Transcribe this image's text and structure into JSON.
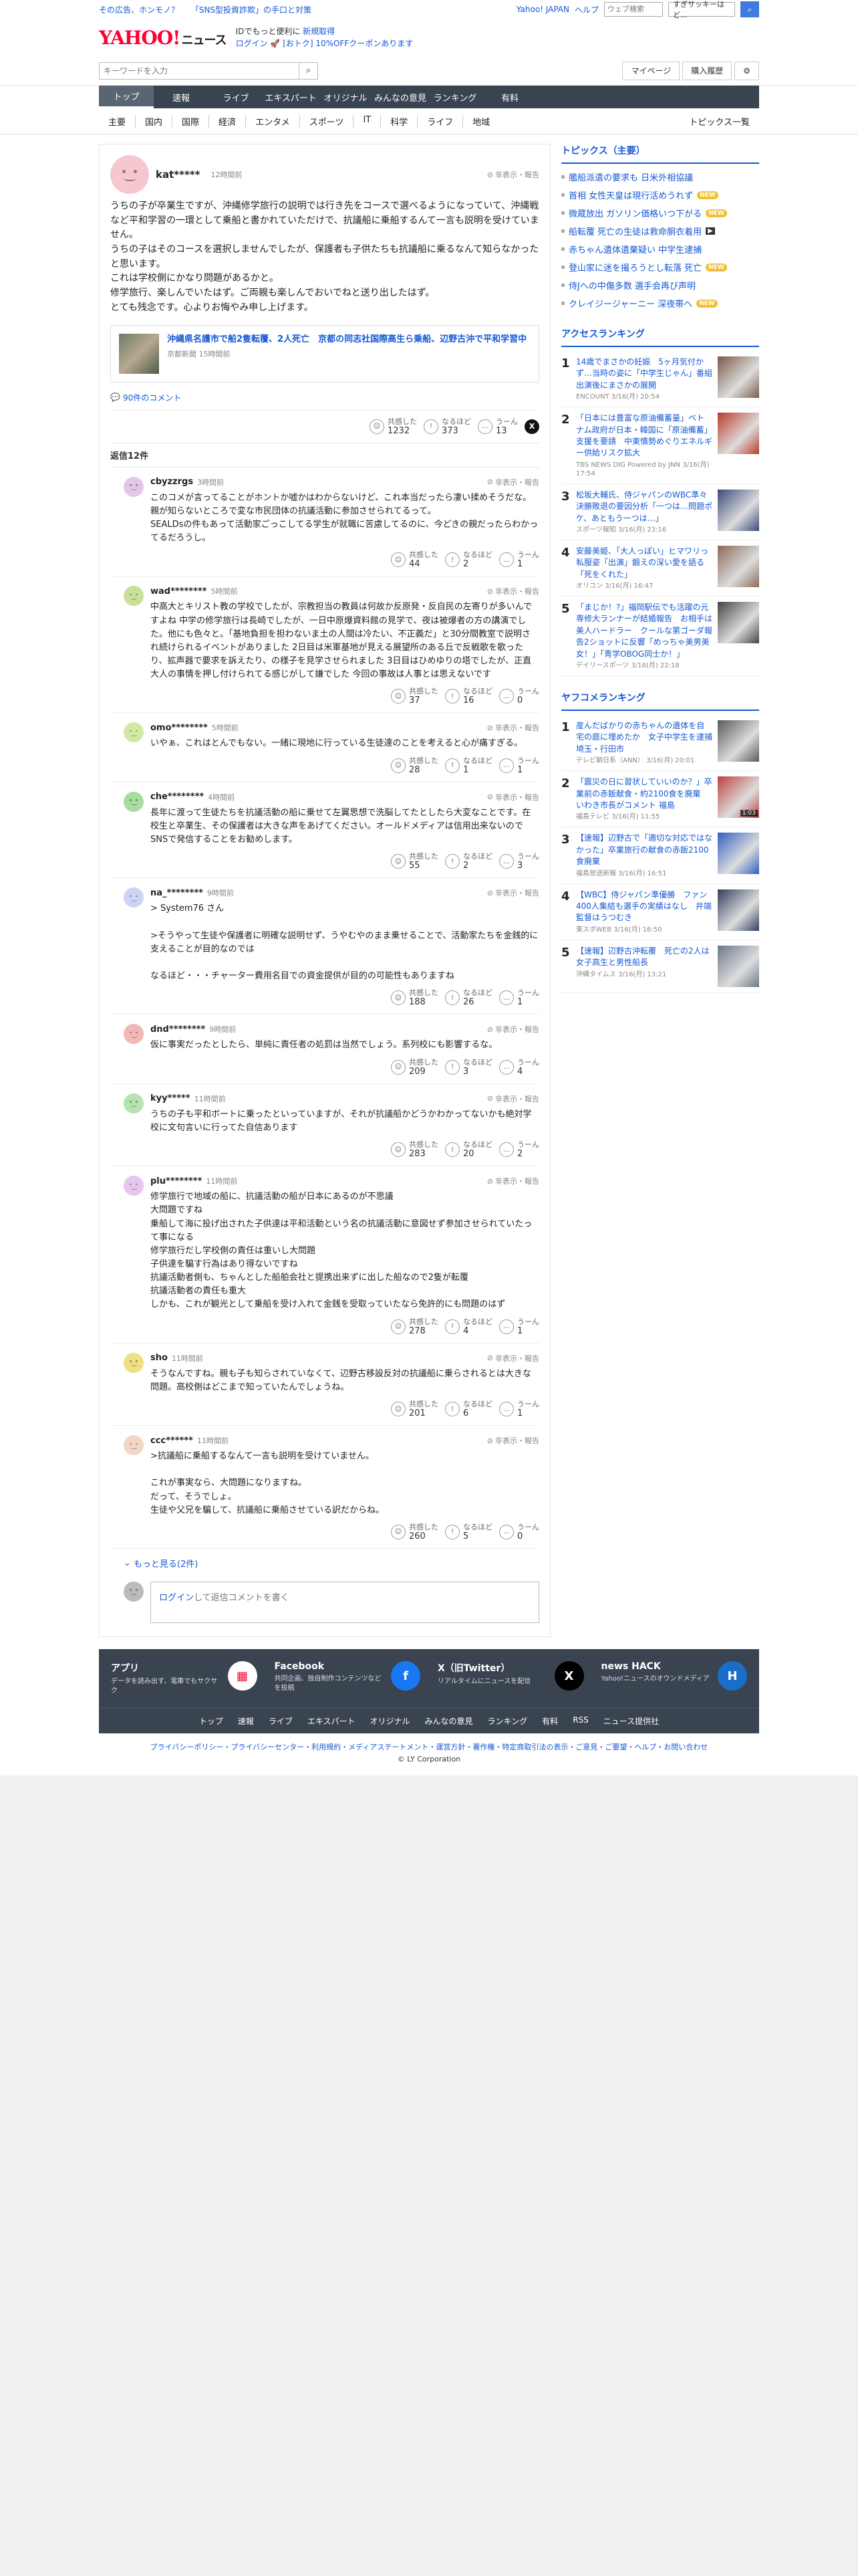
{
  "promo": {
    "links": [
      "その広告、ホンモノ？",
      "「SNS型投資詐欺」の手口と対策"
    ],
    "yahoo_japan": "Yahoo! JAPAN",
    "help": "ヘルプ",
    "search_placeholder": "ウェブ検索",
    "pill": "すぎサッキーはど...",
    "search_icon": "search-icon"
  },
  "masthead": {
    "logo": "YAHOO!",
    "logo_sub": "JAPAN",
    "brand": "ニュース",
    "msg1": "IDでもっと便利に",
    "msg1_link": "新規取得",
    "login": "ログイン",
    "msg2": "[おトク] 10%OFFクーポンあります"
  },
  "searchrow": {
    "placeholder": "キーワードを入力",
    "mypage": "マイページ",
    "purchase": "購入履歴"
  },
  "nav": [
    "トップ",
    "速報",
    "ライブ",
    "エキスパート",
    "オリジナル",
    "みんなの意見",
    "ランキング",
    "有料"
  ],
  "subnav": {
    "items": [
      "主要",
      "国内",
      "国際",
      "経済",
      "エンタメ",
      "スポーツ",
      "IT",
      "科学",
      "ライフ",
      "地域"
    ],
    "topics_list": "トピックス一覧"
  },
  "main_comment": {
    "user": "kat*****",
    "time": "12時間前",
    "report": "非表示・報告",
    "text": "うちの子が卒業生ですが、沖縄修学旅行の説明では行き先をコースで選べるようになっていて、沖縄戦など平和学習の一環として乗船と書かれていただけで、抗議船に乗船するんて一言も説明を受けていません。\nうちの子はそのコースを選択しませんでしたが、保護者も子供たちも抗議船に乗るなんて知らなかったと思います。\nこれは学校側にかなり問題があるかと。\n修学旅行、楽しんでいたはず。ご両親も楽しんでおいでねと送り出したはず。\nとても残念です。心よりお悔やみ申し上げます。",
    "article_title": "沖縄県名護市で船2隻転覆、2人死亡　京都の同志社国際高生ら乗船、辺野古沖で平和学習中",
    "article_src": "京都新聞 15時間前",
    "comments_link": "90件のコメント",
    "agree": "1232",
    "naruhodo": "373",
    "uun": "13"
  },
  "labels": {
    "agree": "共感した",
    "naruhodo": "なるほど",
    "uun": "うーん",
    "report": "非表示・報告"
  },
  "replies_header": "返信12件",
  "replies": [
    {
      "name": "cbyzzrgs",
      "time": "3時間前",
      "color": "#e3c6ea",
      "text": "このコメが言ってることがホントか嘘かはわからないけど、これ本当だったら凄い揉めそうだな。\n親が知らないところで変な市民団体の抗議活動に参加させられてるって。\nSEALDsの件もあって活動家ごっこしてる学生が就職に苦慮してるのに、今どきの親だったらわかってるだろうし。",
      "agree": "44",
      "naruhodo": "2",
      "uun": "1"
    },
    {
      "name": "wad********",
      "time": "5時間前",
      "color": "#c9e09a",
      "text": "中高大とキリスト教の学校でしたが、宗教担当の教員は何故か反原発・反自民の左寄りが多いんですよね 中学の修学旅行は長崎でしたが、一日中原爆資料館の見学で、夜は被爆者の方の講演でした。他にも色々と。「基地負担を担わないま土の人間は冷たい、不正義だ」と30分間教室で説明され続けられるイベントがありました 2日目は米軍基地が見える展望所のある丘で反戦歌を歌ったり、拡声器で要求を訴えたり、の様子を見学させられました 3日目はひめゆりの塔でしたが、正直大人の事情を押し付けられてる感じがして嫌でした 今回の事故は人事とは思えないです",
      "agree": "37",
      "naruhodo": "16",
      "uun": "0"
    },
    {
      "name": "omo********",
      "time": "5時間前",
      "color": "#d4e8a6",
      "text": "いやぁ、これはとんでもない。一緒に現地に行っている生徒達のことを考えると心が痛すぎる。",
      "agree": "28",
      "naruhodo": "1",
      "uun": "1"
    },
    {
      "name": "che********",
      "time": "4時間前",
      "color": "#a8dca0",
      "text": "長年に渡って生徒たちを抗議活動の船に乗せて左翼思想で洗脳してたとしたら大変なことです。在校生と卒業生、その保護者は大きな声をあげてください。オールドメディアは信用出来ないのでSNSで発信することをお勧めします。",
      "agree": "55",
      "naruhodo": "2",
      "uun": "3"
    },
    {
      "name": "na_********",
      "time": "9時間前",
      "color": "#cdd3f2",
      "text": "> System76 さん\n\n>そうやって生徒や保護者に明確な説明せず、うやむやのまま乗せることで、活動家たちを金銭的に支えることが目的なのでは\n\nなるほど・・・チャーター費用名目での資金提供が目的の可能性もありますね",
      "agree": "188",
      "naruhodo": "26",
      "uun": "1"
    },
    {
      "name": "dnd********",
      "time": "9時間前",
      "color": "#f2b8b8",
      "text": "仮に事実だったとしたら、単純に責任者の処罰は当然でしょう。系列校にも影響するな。",
      "agree": "209",
      "naruhodo": "3",
      "uun": "4"
    },
    {
      "name": "kyy*****",
      "time": "11時間前",
      "color": "#b5e3b2",
      "text": "うちの子も平和ボートに乗ったといっていますが、それが抗議船かどうかわかってないかも絶対学校に文句言いに行ってた自信あります",
      "agree": "283",
      "naruhodo": "20",
      "uun": "2"
    },
    {
      "name": "plu********",
      "time": "11時間前",
      "color": "#e8c6ef",
      "text": "修学旅行で地域の船に、抗議活動の船が日本にあるのが不思議\n大問題ですね\n乗船して海に投げ出された子供達は平和活動という名の抗議活動に意図せず参加させられていたって事になる\n修学旅行だし学校側の責任は重いし大問題\n子供達を騙す行為はあり得ないですね\n抗議活動者側も、ちゃんとした船舶会社と提携出来ずに出した船なので2隻が転覆\n抗議活動者の責任も重大\nしかも、これが観光として乗船を受け入れて金銭を受取っていたなら免許的にも問題のはず",
      "agree": "278",
      "naruhodo": "4",
      "uun": "1"
    },
    {
      "name": "sho",
      "time": "11時間前",
      "color": "#f1df86",
      "text": "そうなんですね。親も子も知らされていなくて、辺野古移設反対の抗議船に乗らされるとは大きな問題。高校側はどこまで知っていたんでしょうね。",
      "agree": "201",
      "naruhodo": "6",
      "uun": "1"
    },
    {
      "name": "ccc******",
      "time": "11時間前",
      "color": "#f2d7c8",
      "text": ">抗議船に乗船するなんて一言も説明を受けていません。\n\nこれが事実なら、大問題になりますね。\nだって、そうでしょ。\n生徒や父兄を騙して、抗議船に乗船させている訳だからね。",
      "agree": "260",
      "naruhodo": "5",
      "uun": "0"
    }
  ],
  "more_link": "もっと見る(2件)",
  "post": {
    "login": "ログイン",
    "rest": "して返信コメントを書く"
  },
  "side": {
    "topics_title": "トピックス（主要）",
    "topics": [
      {
        "t": "艦船派遣の要求も 日米外相協議",
        "b": ""
      },
      {
        "t": "首相 女性天皇は現行活めうれず",
        "b": "NEW"
      },
      {
        "t": "微蔵放出 ガソリン価格いつ下がる",
        "b": "NEW"
      },
      {
        "t": "船転覆 死亡の生徒は救命胴衣着用",
        "b": "CAM"
      },
      {
        "t": "赤ちゃん遺体遺棄疑い 中学生逮捕",
        "b": ""
      },
      {
        "t": "登山家に迷を撮ろうとし転落 死亡",
        "b": "NEW"
      },
      {
        "t": "侍Jへの中傷多数 選手会再び声明",
        "b": ""
      },
      {
        "t": "クレイジージャーニー 深夜帯へ",
        "b": "NEW"
      }
    ],
    "access_title": "アクセスランキング",
    "access": [
      {
        "t": "14歳でまさかの妊娠　5ヶ月気付かず…当時の姿に「中学生じゃん」番組出演後にまさかの展開",
        "m": "ENCOUNT 3/16(月) 20:54",
        "img": "#7a5a4a"
      },
      {
        "t": "「日本には豊富な原油備蓄量」ベトナム政府が日本・韓国に「原油備蓄」支援を要請　中東情勢めぐりエネルギー供給リスク拡大",
        "m": "TBS NEWS DIG Powered by JNN 3/16(月) 17:54",
        "img": "#b93a2a"
      },
      {
        "t": "松坂大輔氏、侍ジャパンのWBC準々決勝敗退の要因分析「一つは…問題ポケ、あともう一つは…」",
        "m": "スポーツ報知 3/16(月) 23:16",
        "img": "#3a4a7a"
      },
      {
        "t": "安藤美姫、「大人っぽい」ヒマワリっ私服姿「出演」鍛えの深い愛を語る「死をくれた」",
        "m": "オリコン 3/16(月) 16:47",
        "img": "#8a6a5a"
      },
      {
        "t": "「まじか！?」福岡駅伝でも活躍の元専修大ランナーが結婚報告　お相手は美人ハードラー　クールな第ゴーダ報告2ショットに反響「めっちゃ美男美女！」「青学OBOG同士か！」",
        "m": "デイリースポーツ 3/16(月) 22:18",
        "img": "#444444"
      }
    ],
    "comment_title": "ヤフコメランキング",
    "comment": [
      {
        "t": "産んだばかりの赤ちゃんの遺体を自宅の庭に埋めたか　女子中学生を逮捕　埼玉・行田市",
        "m": "テレビ朝日系（ANN） 3/16(月) 20:01",
        "img": "#5a5a5a",
        "v": ""
      },
      {
        "t": "「震災の日に習状していいのか？」卒業前の赤飯献食・約2100食を廃棄　いわき市長がコメント 福島",
        "m": "福島テレビ 3/16(月) 11:55",
        "img": "#c04040",
        "v": "1:03"
      },
      {
        "t": "【速報】辺野古で「適切な対応ではなかった」卒業旅行の献食の赤飯2100食廃棄",
        "m": "福島放送新報 3/16(月) 16:51",
        "img": "#3060c0",
        "v": ""
      },
      {
        "t": "【WBC】侍ジャパン準優勝　ファン400人集結も選手の実績はなし　井端監督はうつむき",
        "m": "東スポWEB 3/16(月) 16:50",
        "img": "#304060",
        "v": ""
      },
      {
        "t": "【速報】辺野古沖転覆　死亡の2人は女子高生と男性船長",
        "m": "沖縄タイムス 3/16(月) 13:21",
        "img": "#6a7a8a",
        "v": ""
      }
    ]
  },
  "footer": {
    "cards": [
      {
        "t": "アプリ",
        "d": "データを読み出す、電車でもサクサク",
        "i": "app-icon",
        "g": "▦"
      },
      {
        "t": "Facebook",
        "d": "共同企画、独自制作コンテンツなどを投稿",
        "i": "facebook-icon",
        "g": "f"
      },
      {
        "t": "X（旧Twitter）",
        "d": "リアルタイムにニュースを配信",
        "i": "x-icon",
        "g": "X"
      },
      {
        "t": "news HACK",
        "d": "Yahoo!ニュースのオウンドメディア",
        "i": "newshack-icon",
        "g": "H"
      }
    ],
    "links": [
      "トップ",
      "速報",
      "ライブ",
      "エキスパート",
      "オリジナル",
      "みんなの意見",
      "ランキング",
      "有料",
      "RSS",
      "ニュース提供社"
    ],
    "legal": "プライバシーポリシー・プライバシーセンター・利用規約・メディアステートメント・運営方針・著作権・特定商取引法の表示・ご意見・ご要望・ヘルプ・お問い合わせ",
    "copyright": "© LY Corporation"
  }
}
